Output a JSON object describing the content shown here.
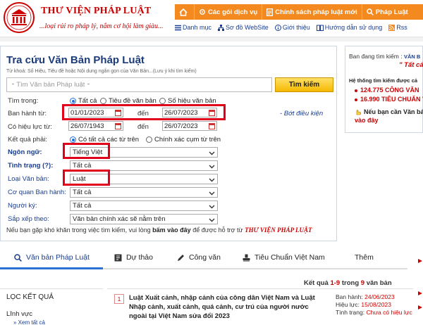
{
  "header": {
    "brand": "THƯ VIỆN PHÁP LUẬT",
    "slogan": "...loại rủi ro pháp lý, nắm cơ hội làm giàu...",
    "topnav": [
      {
        "label": "",
        "icon": "home-icon"
      },
      {
        "label": "Các gói dịch vụ",
        "icon": "gear-icon"
      },
      {
        "label": "Chính sách pháp luật mới",
        "icon": "document-icon"
      },
      {
        "label": "Pháp Luật",
        "icon": "search-icon"
      }
    ],
    "subnav": [
      {
        "label": "Danh mục",
        "icon": "list-icon"
      },
      {
        "label": "Sơ đồ WebSite",
        "icon": "sitemap-icon"
      },
      {
        "label": "Giới thiệu",
        "icon": "info-icon"
      },
      {
        "label": "Hướng dẫn sử dụng",
        "icon": "book-icon"
      },
      {
        "label": "Rss",
        "icon": "rss-icon"
      }
    ]
  },
  "search": {
    "title": "Tra cứu Văn Bản Pháp Luật",
    "hint": "Từ khoá: Số Hiệu, Tiêu đề hoặc Nội dung ngắn gọn của Văn Bản...(Lưu ý khi tìm kiếm)",
    "placeholder": "Tìm Văn bản Pháp luật",
    "button": "Tìm kiếm",
    "scope_label": "Tìm trong:",
    "scope_options": [
      "Tất cả",
      "Tiêu đề văn bản",
      "Số hiệu văn bản"
    ],
    "issued_label": "Ban hành từ:",
    "issued_from": "01/01/2023",
    "issued_to": "26/07/2023",
    "to_word": "đến",
    "remove_filter": "- Bớt điều kiện",
    "effective_label": "Có hiệu lực từ:",
    "effective_from": "26/07/1943",
    "effective_to": "26/07/2023",
    "result_label": "Kết quả phải:",
    "result_options": [
      "Có tất cả các từ trên",
      "Chính xác cụm từ trên"
    ],
    "language_label": "Ngôn ngữ:",
    "language_value": "Tiếng Việt",
    "status_label": "Tình trạng (?):",
    "status_value": "Tất cả",
    "type_label": "Loại Văn bản:",
    "type_value": "Luật",
    "agency_label": "Cơ quan Ban hành:",
    "agency_value": "Tất cả",
    "signer_label": "Người ký:",
    "signer_value": "Tất cả",
    "sort_label": "Sắp xếp theo:",
    "sort_value": "Văn bản chính xác sẽ nằm trên",
    "note_pre": "Nếu bạn gặp khó khăn trong việc tìm kiếm, vui lòng",
    "note_bold": "bấm vào đây",
    "note_mid": "để được hỗ trợ từ",
    "note_brand": "THƯ VIỆN PHÁP LUẬT"
  },
  "sidebar": {
    "searching_label": "Ban đang tìm kiếm :",
    "searching_value": "VĂN B",
    "query_value": "\" Tất cả",
    "system_label": "Hệ thống tìm kiếm được cả",
    "stat1": "124.775 CÔNG VĂN",
    "stat2": "16.990 TIÊU CHUẨN V",
    "need_label": "Nếu bạn cần Văn bả",
    "need_link": "vào đây"
  },
  "tabs": [
    {
      "label": "Văn bản Pháp Luật",
      "icon": "search-icon"
    },
    {
      "label": "Dự thảo",
      "icon": "draft-icon"
    },
    {
      "label": "Công văn",
      "icon": "pen-icon"
    },
    {
      "label": "Tiêu Chuẩn Việt Nam",
      "icon": "stamp-icon"
    },
    {
      "label": "Thêm",
      "icon": ""
    }
  ],
  "results": {
    "summary_pre": "Kết quả",
    "range": "1-9",
    "summary_mid": "trong",
    "total": "9",
    "summary_post": "văn bản",
    "filter_title": "LỌC KẾT QUẢ",
    "filter_field": "Lĩnh vực",
    "filter_link": "Xem tất cả",
    "items": [
      {
        "num": "1",
        "title": "Luật Xuất cảnh, nhập cảnh của công dân Việt Nam và Luật Nhập cảnh, xuất cảnh, quá cảnh, cư trú của người nước ngoài tại Việt Nam sửa đổi 2023",
        "issued_label": "Ban hành:",
        "issued": "24/06/2023",
        "effective_label": "Hiệu lực:",
        "effective": "15/08/2023",
        "status_label": "Tình trạng:",
        "status": "Chưa có hiệu lực"
      }
    ]
  },
  "colors": {
    "brand_red": "#cc0000",
    "nav_orange": "#f48a1f",
    "link_blue": "#1a3d8f",
    "highlight_box": "#e0001b"
  }
}
